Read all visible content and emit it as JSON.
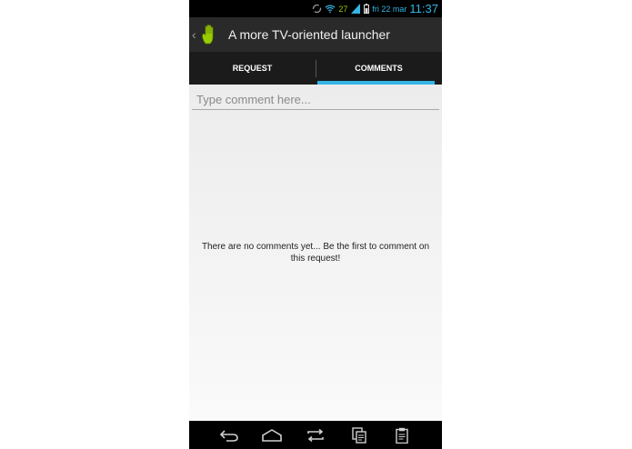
{
  "status_bar": {
    "battery_text": "27",
    "date": "fri 22 mar",
    "time": "11:37",
    "icons": [
      "sync-icon",
      "wifi-icon",
      "signal-icon",
      "battery-icon"
    ]
  },
  "action_bar": {
    "title": "A more TV-oriented launcher",
    "app_icon": "hand-icon",
    "accent_color": "#99cc00"
  },
  "tabs": [
    {
      "label": "REQUEST",
      "active": false
    },
    {
      "label": "COMMENTS",
      "active": true
    }
  ],
  "tab_indicator_color": "#33b5e5",
  "comment_input": {
    "placeholder": "Type comment here...",
    "value": ""
  },
  "empty_message": "There are no comments yet... Be the first to comment on this request!",
  "nav_bar": {
    "buttons": [
      "back-icon",
      "home-icon",
      "recent-apps-icon",
      "copy-icon",
      "clipboard-icon"
    ]
  }
}
